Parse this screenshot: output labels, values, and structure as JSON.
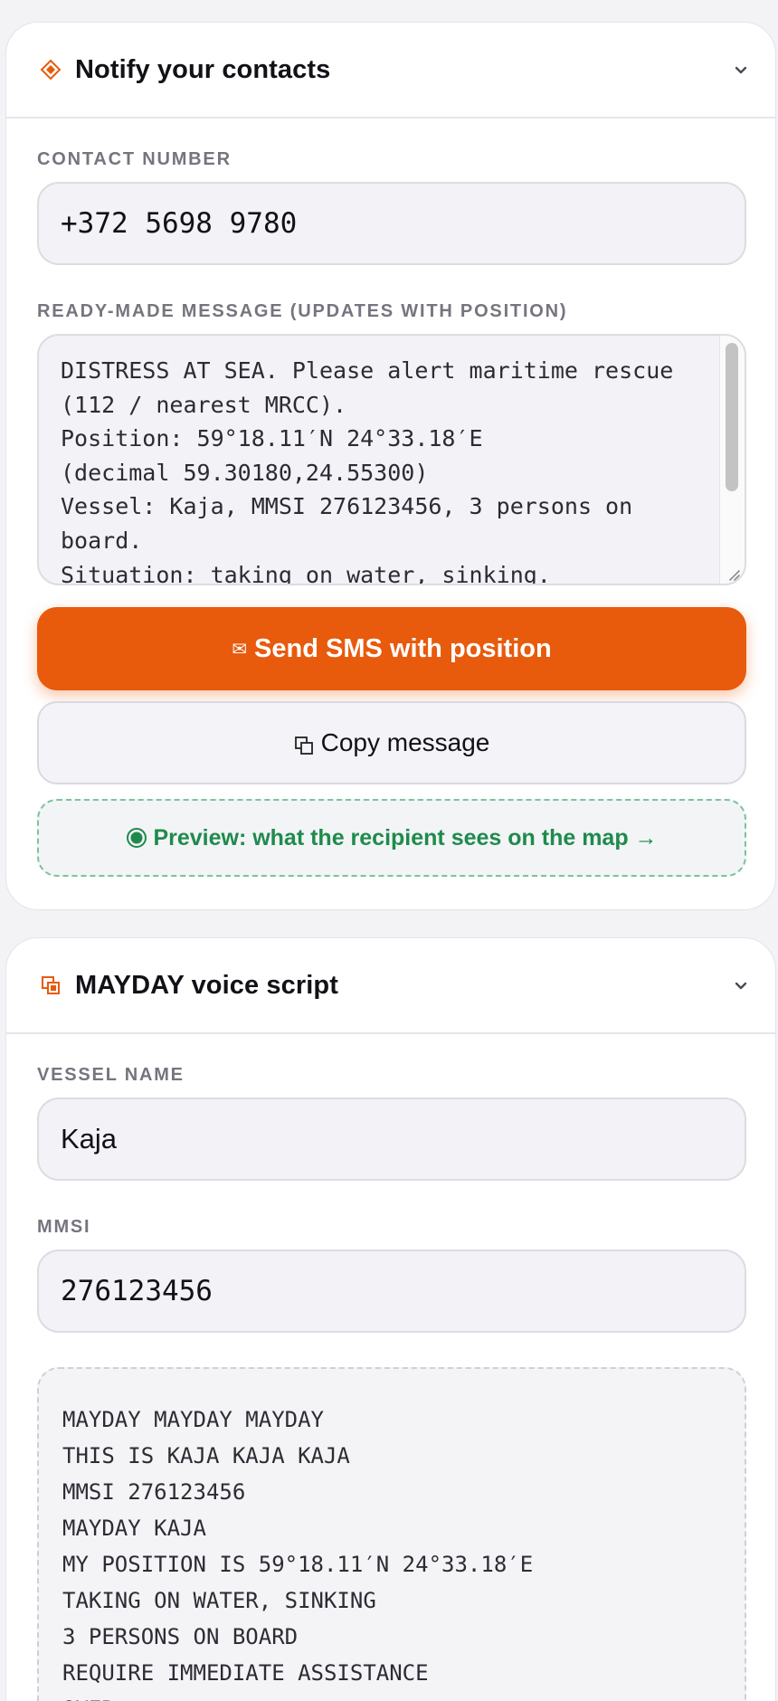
{
  "notify_card": {
    "title": "Notify your contacts",
    "icon": "diamond-icon",
    "contact_number_label": "CONTACT NUMBER",
    "contact_number_value": "+372 5698 9780",
    "message_label": "READY-MADE MESSAGE (UPDATES WITH POSITION)",
    "message_text": "DISTRESS AT SEA. Please alert maritime rescue (112 / nearest MRCC).\nPosition: 59°18.11′N 24°33.18′E\n(decimal 59.30180,24.55300)\nVessel: Kaja, MMSI 276123456, 3 persons on board.\nSituation: taking on water, sinking.",
    "send_button_label": "Send SMS with position",
    "send_button_icon": "✉",
    "copy_button_label": "Copy message",
    "preview_link_label": "Preview: what the recipient sees on the map →"
  },
  "mayday_card": {
    "title": "MAYDAY voice script",
    "icon": "copy-squares-icon",
    "vessel_name_label": "VESSEL NAME",
    "vessel_name_value": "Kaja",
    "mmsi_label": "MMSI",
    "mmsi_value": "276123456",
    "script_text": "MAYDAY MAYDAY MAYDAY\nTHIS IS KAJA KAJA KAJA\nMMSI 276123456\nMAYDAY KAJA\nMY POSITION IS 59°18.11′N 24°33.18′E\nTAKING ON WATER, SINKING\n3 PERSONS ON BOARD\nREQUIRE IMMEDIATE ASSISTANCE\nOVER"
  },
  "colors": {
    "accent": "#e85a0c",
    "preview_green": "#1f8a4c"
  }
}
